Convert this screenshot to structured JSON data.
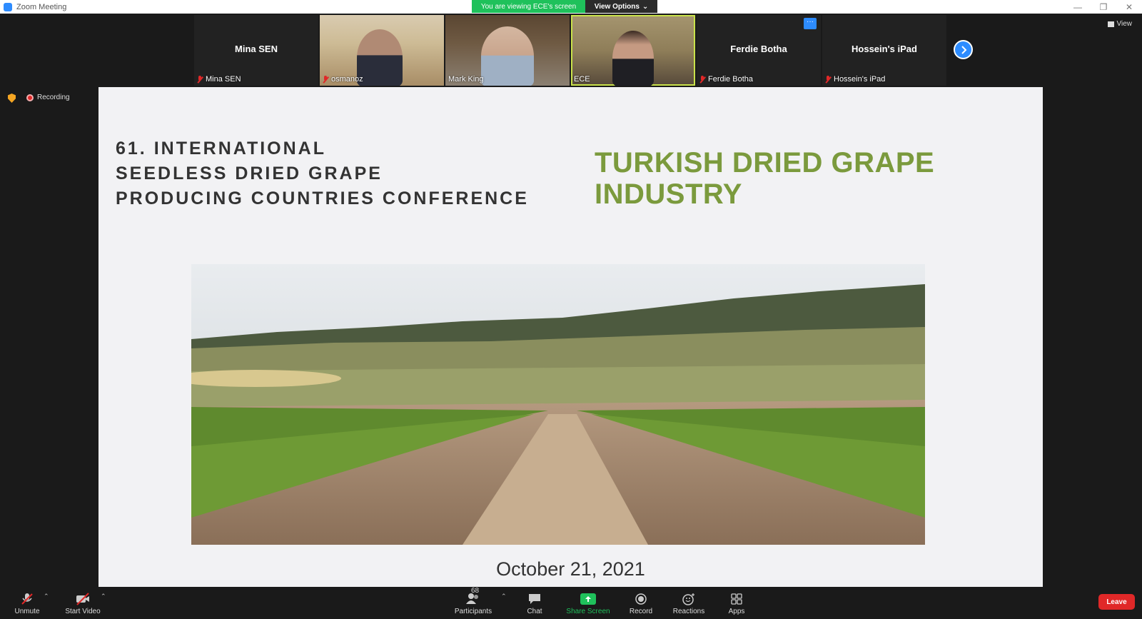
{
  "window": {
    "title": "Zoom Meeting",
    "controls": [
      "—",
      "❐",
      "✕"
    ]
  },
  "share_banner": {
    "text": "You are viewing ECE's screen",
    "view_options": "View Options"
  },
  "top_right": {
    "view_label": "View"
  },
  "participants": [
    {
      "big_name": "Mina SEN",
      "label": "Mina SEN",
      "muted": true,
      "video": false
    },
    {
      "big_name": "",
      "label": "osmanoz",
      "muted": true,
      "video": true
    },
    {
      "big_name": "",
      "label": "Mark King",
      "muted": false,
      "video": true
    },
    {
      "big_name": "",
      "label": "ECE",
      "muted": false,
      "video": true,
      "active": true
    },
    {
      "big_name": "Ferdie Botha",
      "label": "Ferdie Botha",
      "muted": true,
      "video": false
    },
    {
      "big_name": "Hossein's iPad",
      "label": "Hossein's iPad",
      "muted": true,
      "video": false
    }
  ],
  "recording": {
    "label": "Recording"
  },
  "slide": {
    "conference_lines": [
      "61. INTERNATIONAL",
      "SEEDLESS DRIED GRAPE",
      "PRODUCING COUNTRIES CONFERENCE"
    ],
    "industry_lines": [
      "TURKISH DRIED GRAPE",
      "INDUSTRY"
    ],
    "date": "October 21, 2021",
    "title_color": "#7b9a3d"
  },
  "toolbar": {
    "unmute": "Unmute",
    "start_video": "Start Video",
    "participants": "Participants",
    "participant_count": "68",
    "chat": "Chat",
    "share_screen": "Share Screen",
    "record": "Record",
    "reactions": "Reactions",
    "apps": "Apps",
    "leave": "Leave"
  },
  "colors": {
    "accent": "#2d8cff",
    "share_green": "#1fc15b",
    "leave_red": "#e02828"
  }
}
